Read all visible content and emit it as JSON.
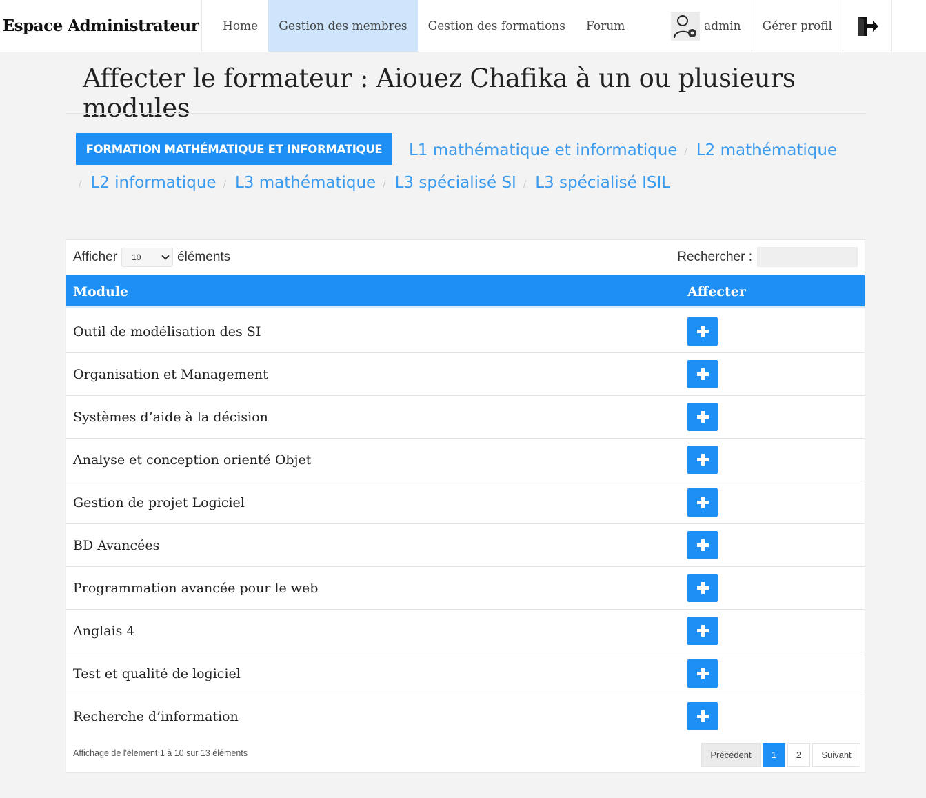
{
  "navbar": {
    "brand": "Espace Administrateur",
    "links": [
      "Home",
      "Gestion des membres",
      "Gestion des formations",
      "Forum"
    ],
    "active_link": "Gestion des membres",
    "user_name": "admin",
    "manage_profile": "Gérer profil",
    "logout_icon": "logout-icon"
  },
  "page": {
    "title": "Affecter le formateur : Aiouez Chafika à un ou plusieurs modules"
  },
  "breadcrumb": {
    "formation": "FORMATION MATHÉMATIQUE ET INFORMATIQUE",
    "levels": [
      "L1 mathématique et informatique",
      "L2 mathématique",
      "L2 informatique",
      "L3 mathématique",
      "L3 spécialisé SI",
      "L3 spécialisé ISIL"
    ],
    "separator": "/"
  },
  "table": {
    "show_label": "Afficher",
    "show_value": "10",
    "show_suffix": "éléments",
    "search_label": "Rechercher :",
    "search_value": "",
    "columns": [
      "Module",
      "Affecter"
    ],
    "rows": [
      "Outil de modélisation des SI",
      "Organisation et Management",
      "Systèmes d’aide à la décision",
      "Analyse et conception orienté Objet",
      "Gestion de projet Logiciel",
      "BD Avancées",
      "Programmation avancée pour le web",
      "Anglais 4",
      "Test et qualité de logiciel",
      "Recherche d’information"
    ],
    "action_icon": "plus-icon",
    "info": "Affichage de l'élement 1 à 10 sur 13 éléments",
    "pagination": {
      "previous": "Précédent",
      "pages": [
        "1",
        "2"
      ],
      "current": "1",
      "next": "Suivant"
    }
  },
  "colors": {
    "accent": "#1e8ff5",
    "link": "#3b9bef",
    "active_nav_bg": "#cfe5fb",
    "background": "#f3f3f3"
  }
}
